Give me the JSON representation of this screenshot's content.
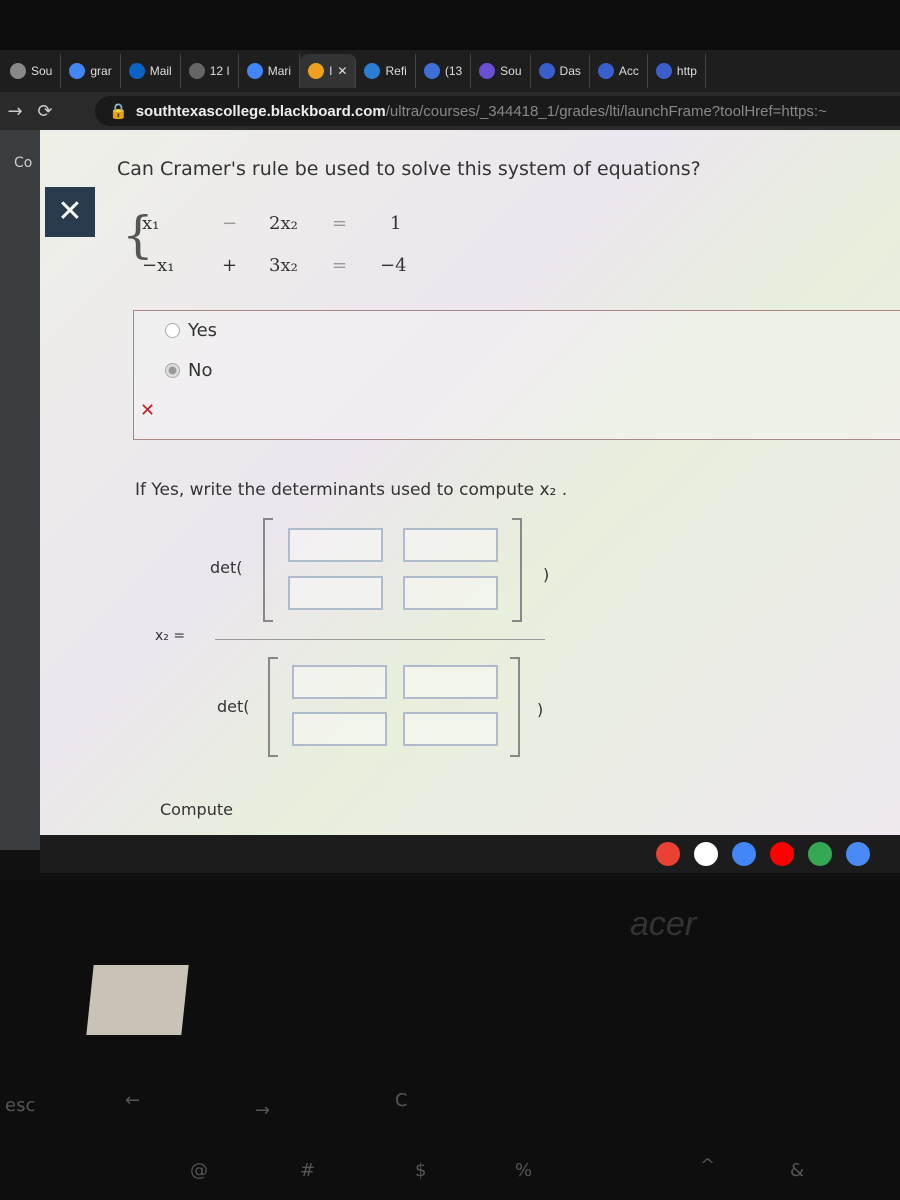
{
  "browser": {
    "tabs": [
      {
        "label": "Sou",
        "icon": "page-icon",
        "color": "#888888"
      },
      {
        "label": "grar",
        "icon": "google-icon",
        "color": "#4285f4"
      },
      {
        "label": "Mail",
        "icon": "outlook-icon",
        "color": "#0a64c8"
      },
      {
        "label": "12 I",
        "icon": "tab-icon",
        "color": "#666666"
      },
      {
        "label": "Mari",
        "icon": "google-icon",
        "color": "#4285f4"
      },
      {
        "label": "I",
        "icon": "pencil-icon",
        "color": "#f0a020",
        "active": true
      },
      {
        "label": "Refi",
        "icon": "word-icon",
        "color": "#2b7cd3"
      },
      {
        "label": "(13",
        "icon": "mail-icon",
        "color": "#3d6fd8"
      },
      {
        "label": "Sou",
        "icon": "star-icon",
        "color": "#6a4fd0"
      },
      {
        "label": "Das",
        "icon": "blackboard-icon",
        "color": "#3a5fcd"
      },
      {
        "label": "Acc",
        "icon": "blackboard-icon",
        "color": "#3a5fcd"
      },
      {
        "label": "http",
        "icon": "blackboard-icon",
        "color": "#3a5fcd"
      }
    ],
    "url_domain": "southtexascollege.blackboard.com",
    "url_path": "/ultra/courses/_344418_1/grades/lti/launchFrame?toolHref=https:~"
  },
  "sidebar": {
    "partial_label": "Co"
  },
  "question": {
    "text": "Can Cramer's rule be used to solve this system of equations?",
    "equations": [
      {
        "a": "x₁",
        "op": "−",
        "b": "2x₂",
        "eq": "=",
        "rhs": "1"
      },
      {
        "a": "−x₁",
        "op": "+",
        "b": "3x₂",
        "eq": "=",
        "rhs": "−4"
      }
    ],
    "options": [
      {
        "label": "Yes",
        "selected": false
      },
      {
        "label": "No",
        "selected": true
      }
    ],
    "feedback": "incorrect",
    "feedback_symbol": "✕"
  },
  "followup": {
    "prompt": "If Yes, write the determinants used to compute x₂ .",
    "lhs": "x₂ =",
    "det_label": "det(",
    "det_close": ")",
    "compute_label": "Compute"
  },
  "shelf_apps": [
    {
      "name": "chrome",
      "color": "#e94235"
    },
    {
      "name": "gmail",
      "color": "#ffffff"
    },
    {
      "name": "docs",
      "color": "#4285f4"
    },
    {
      "name": "youtube",
      "color": "#ff0000"
    },
    {
      "name": "play",
      "color": "#34a853"
    },
    {
      "name": "messages",
      "color": "#4a8af4"
    }
  ],
  "device": {
    "brand": "acer",
    "keys": [
      "esc",
      "←",
      "→",
      "C",
      "@",
      "#",
      "$",
      "%",
      "^",
      "&"
    ]
  }
}
